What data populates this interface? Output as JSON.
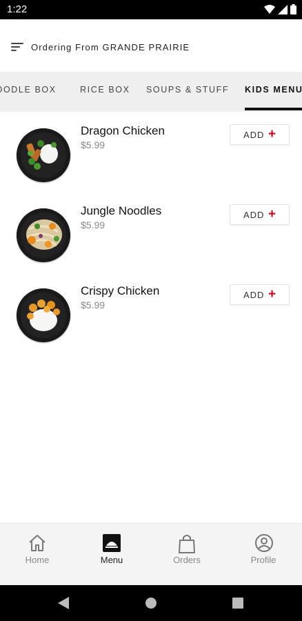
{
  "status_bar": {
    "time": "1:22"
  },
  "header": {
    "ordering_text": "Ordering From GRANDE PRAIRIE"
  },
  "tabs": [
    {
      "label": "NOODLE BOX",
      "active": false
    },
    {
      "label": "RICE BOX",
      "active": false
    },
    {
      "label": "SOUPS & STUFF",
      "active": false
    },
    {
      "label": "KIDS MENU",
      "active": true
    }
  ],
  "menu_items": [
    {
      "name": "Dragon Chicken",
      "price": "$5.99",
      "add_label": "ADD",
      "add_icon": "+"
    },
    {
      "name": "Jungle Noodles",
      "price": "$5.99",
      "add_label": "ADD",
      "add_icon": "+"
    },
    {
      "name": "Crispy Chicken",
      "price": "$5.99",
      "add_label": "ADD",
      "add_icon": "+"
    }
  ],
  "bottom_nav": [
    {
      "label": "Home",
      "icon": "home-icon",
      "active": false
    },
    {
      "label": "Menu",
      "icon": "menu-icon",
      "active": true
    },
    {
      "label": "Orders",
      "icon": "bag-icon",
      "active": false
    },
    {
      "label": "Profile",
      "icon": "profile-icon",
      "active": false
    }
  ],
  "colors": {
    "accent": "#d0021b",
    "active_tab": "#111111",
    "nav_inactive": "#888888"
  }
}
